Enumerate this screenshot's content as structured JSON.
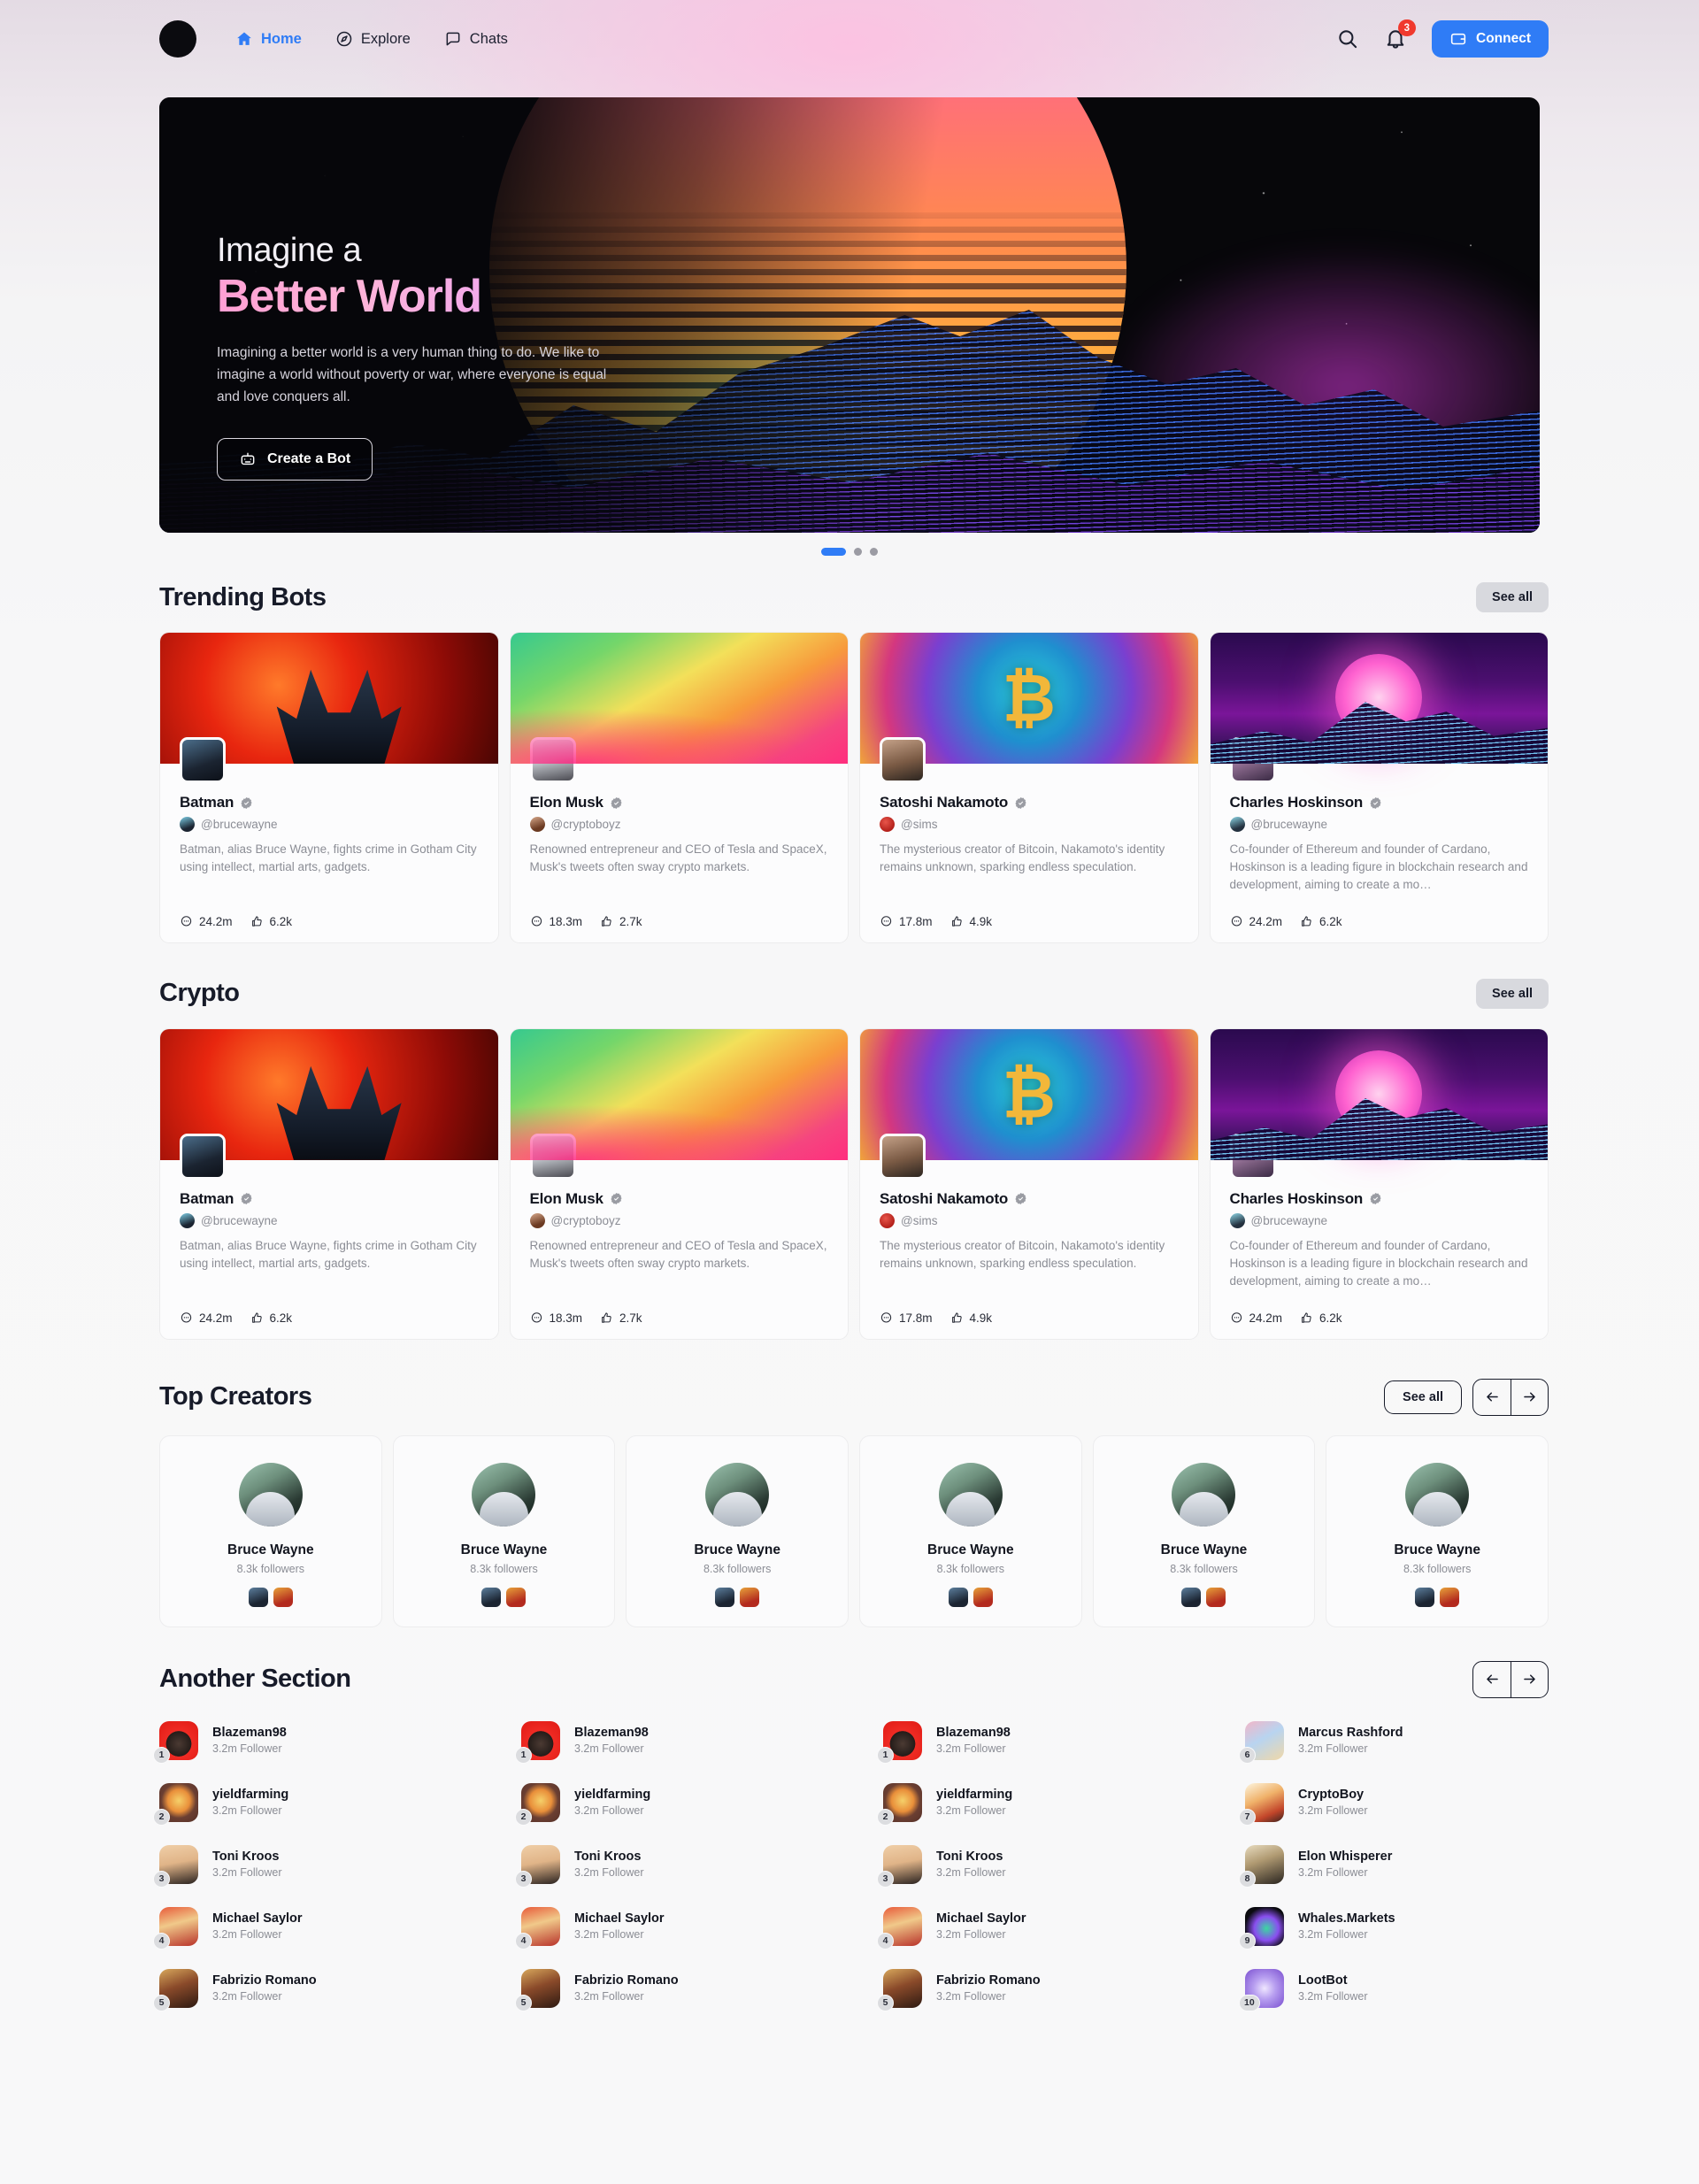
{
  "header": {
    "nav": [
      {
        "label": "Home",
        "icon": "home-icon",
        "active": true
      },
      {
        "label": "Explore",
        "icon": "compass-icon",
        "active": false
      },
      {
        "label": "Chats",
        "icon": "chat-icon",
        "active": false
      }
    ],
    "search_icon": "search-icon",
    "bell_icon": "bell-icon",
    "notification_count": "3",
    "connect_label": "Connect",
    "connect_icon": "wallet-icon",
    "accent": "#2f7cf6",
    "badge_color": "#f0392d"
  },
  "hero": {
    "title_line1": "Imagine a",
    "title_line2": "Better World",
    "paragraph": "Imagining a better world is a very human thing to do. We like to imagine a world without poverty or war, where everyone is equal and love conquers all.",
    "button_label": "Create a Bot",
    "button_icon": "robot-icon",
    "dots": [
      true,
      false,
      false
    ]
  },
  "trending": {
    "title": "Trending Bots",
    "see_all": "See all",
    "cards": [
      {
        "name": "Batman",
        "handle": "@brucewayne",
        "desc": "Batman, alias Bruce Wayne, fights crime in Gotham City using intellect, martial arts, gadgets.",
        "comments": "24.2m",
        "likes": "6.2k",
        "verified": true
      },
      {
        "name": "Elon Musk",
        "handle": "@cryptoboyz",
        "desc": "Renowned entrepreneur and CEO of Tesla and SpaceX, Musk's tweets often sway crypto markets.",
        "comments": "18.3m",
        "likes": "2.7k",
        "verified": true
      },
      {
        "name": "Satoshi Nakamoto",
        "handle": "@sims",
        "desc": "The mysterious creator of Bitcoin, Nakamoto's identity remains unknown, sparking endless speculation.",
        "comments": "17.8m",
        "likes": "4.9k",
        "verified": true
      },
      {
        "name": "Charles Hoskinson",
        "handle": "@brucewayne",
        "desc": "Co-founder of Ethereum and founder of Cardano, Hoskinson is a leading  figure in blockchain research and development, aiming to create a mo…",
        "comments": "24.2m",
        "likes": "6.2k",
        "verified": true
      }
    ]
  },
  "crypto": {
    "title": "Crypto",
    "see_all": "See all",
    "cards": [
      {
        "name": "Batman",
        "handle": "@brucewayne",
        "desc": "Batman, alias Bruce Wayne, fights crime in Gotham City using intellect, martial arts, gadgets.",
        "comments": "24.2m",
        "likes": "6.2k",
        "verified": true
      },
      {
        "name": "Elon Musk",
        "handle": "@cryptoboyz",
        "desc": "Renowned entrepreneur and CEO of Tesla and SpaceX, Musk's tweets often sway crypto markets.",
        "comments": "18.3m",
        "likes": "2.7k",
        "verified": true
      },
      {
        "name": "Satoshi Nakamoto",
        "handle": "@sims",
        "desc": "The mysterious creator of Bitcoin, Nakamoto's identity remains unknown, sparking endless speculation.",
        "comments": "17.8m",
        "likes": "4.9k",
        "verified": true
      },
      {
        "name": "Charles Hoskinson",
        "handle": "@brucewayne",
        "desc": "Co-founder of Ethereum and founder of Cardano, Hoskinson is a leading  figure in blockchain research and development, aiming to create a mo…",
        "comments": "24.2m",
        "likes": "6.2k",
        "verified": true
      }
    ]
  },
  "top_creators": {
    "title": "Top Creators",
    "see_all": "See all",
    "prev_icon": "arrow-left-icon",
    "next_icon": "arrow-right-icon",
    "items": [
      {
        "name": "Bruce Wayne",
        "followers": "8.3k followers"
      },
      {
        "name": "Bruce Wayne",
        "followers": "8.3k followers"
      },
      {
        "name": "Bruce Wayne",
        "followers": "8.3k followers"
      },
      {
        "name": "Bruce Wayne",
        "followers": "8.3k followers"
      },
      {
        "name": "Bruce Wayne",
        "followers": "8.3k followers"
      },
      {
        "name": "Bruce Wayne",
        "followers": "8.3k followers"
      }
    ]
  },
  "another_section": {
    "title": "Another Section",
    "prev_icon": "arrow-left-icon",
    "next_icon": "arrow-right-icon",
    "columns": [
      [
        {
          "rank": "1",
          "name": "Blazeman98",
          "followers": "3.2m Follower",
          "av": "a-blaze"
        },
        {
          "rank": "2",
          "name": "yieldfarming",
          "followers": "3.2m Follower",
          "av": "a-yield"
        },
        {
          "rank": "3",
          "name": "Toni Kroos",
          "followers": "3.2m Follower",
          "av": "a-toni"
        },
        {
          "rank": "4",
          "name": "Michael Saylor",
          "followers": "3.2m Follower",
          "av": "a-saylor"
        },
        {
          "rank": "5",
          "name": "Fabrizio Romano",
          "followers": "3.2m Follower",
          "av": "a-fab"
        }
      ],
      [
        {
          "rank": "1",
          "name": "Blazeman98",
          "followers": "3.2m Follower",
          "av": "a-blaze"
        },
        {
          "rank": "2",
          "name": "yieldfarming",
          "followers": "3.2m Follower",
          "av": "a-yield"
        },
        {
          "rank": "3",
          "name": "Toni Kroos",
          "followers": "3.2m Follower",
          "av": "a-toni"
        },
        {
          "rank": "4",
          "name": "Michael Saylor",
          "followers": "3.2m Follower",
          "av": "a-saylor"
        },
        {
          "rank": "5",
          "name": "Fabrizio Romano",
          "followers": "3.2m Follower",
          "av": "a-fab"
        }
      ],
      [
        {
          "rank": "1",
          "name": "Blazeman98",
          "followers": "3.2m Follower",
          "av": "a-blaze"
        },
        {
          "rank": "2",
          "name": "yieldfarming",
          "followers": "3.2m Follower",
          "av": "a-yield"
        },
        {
          "rank": "3",
          "name": "Toni Kroos",
          "followers": "3.2m Follower",
          "av": "a-toni"
        },
        {
          "rank": "4",
          "name": "Michael Saylor",
          "followers": "3.2m Follower",
          "av": "a-saylor"
        },
        {
          "rank": "5",
          "name": "Fabrizio Romano",
          "followers": "3.2m Follower",
          "av": "a-fab"
        }
      ],
      [
        {
          "rank": "6",
          "name": "Marcus Rashford",
          "followers": "3.2m Follower",
          "av": "a-marcus"
        },
        {
          "rank": "7",
          "name": "CryptoBoy",
          "followers": "3.2m Follower",
          "av": "a-crypto"
        },
        {
          "rank": "8",
          "name": "Elon Whisperer",
          "followers": "3.2m Follower",
          "av": "a-elonw"
        },
        {
          "rank": "9",
          "name": "Whales.Markets",
          "followers": "3.2m Follower",
          "av": "a-whales"
        },
        {
          "rank": "10",
          "name": "LootBot",
          "followers": "3.2m Follower",
          "av": "a-loot"
        }
      ]
    ]
  }
}
